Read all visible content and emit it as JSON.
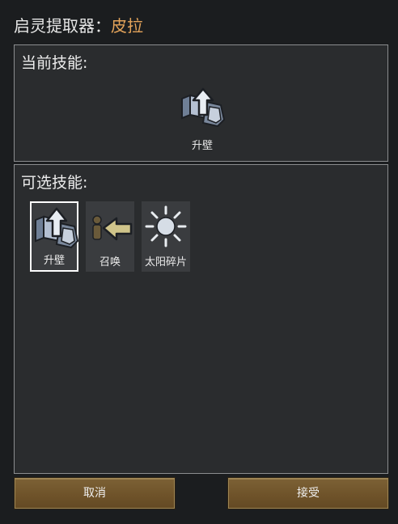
{
  "window": {
    "title_prefix": "启灵提取器：",
    "pawn_name": "皮拉"
  },
  "current": {
    "header": "当前技能:",
    "ability": {
      "label": "升壁",
      "icon": "wall-raise-icon"
    }
  },
  "available": {
    "header": "可选技能:",
    "abilities": [
      {
        "label": "升壁",
        "icon": "wall-raise-icon",
        "selected": true
      },
      {
        "label": "召唤",
        "icon": "summon-icon",
        "selected": false
      },
      {
        "label": "太阳碎片",
        "icon": "sun-shard-icon",
        "selected": false
      }
    ]
  },
  "buttons": {
    "cancel": "取消",
    "accept": "接受"
  },
  "colors": {
    "pawn_name": "#e3a35a",
    "button": "#6e5229",
    "panel": "#2a2c2e"
  }
}
